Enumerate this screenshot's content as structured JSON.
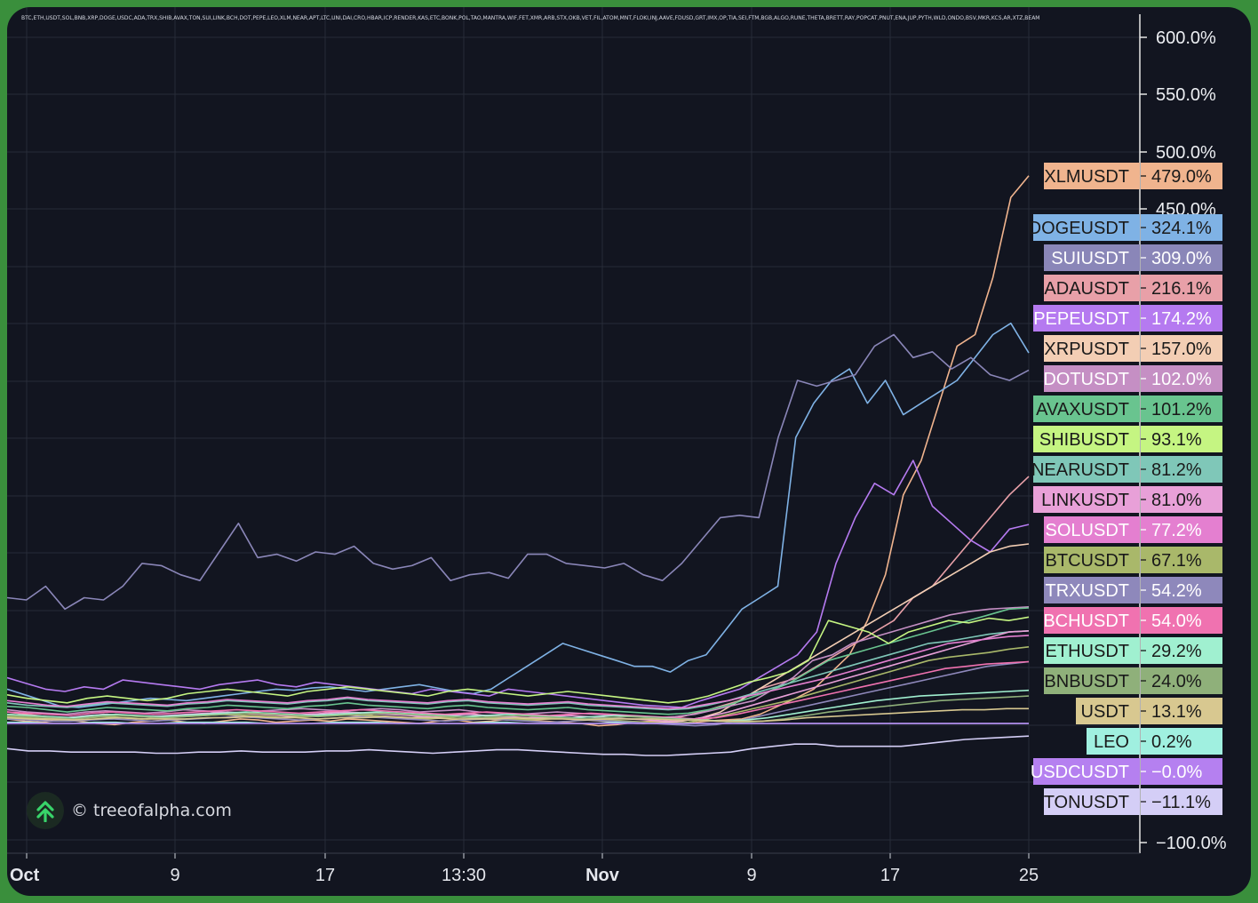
{
  "watermark": {
    "text": "© treeofalpha.com",
    "logo_icon": "tree-of-alpha-logo"
  },
  "chart_data": {
    "type": "line",
    "title": "BTC,ETH,USDT,SOL,BNB,XRP,DOGE,USDC,ADA,TRX,SHIB,AVAX,TON,SUI,LINK,BCH,DOT,PEPE,LEO,XLM,NEAR,APT,LTC,UNI,DAI,CRO,HBAR,ICP,RENDER,KAS,ETC,BONK,POL,TAO,MANTRA,WIF,FET,XMR,ARB,STX,OKB,VET,FIL,ATOM,MNT,FLOKI,INJ,AAVE,FDUSD,GRT,IMX,OP,TIA,SEI,FTM,BGB,ALGO,RUNE,THETA,BRETT,RAY,POPCAT,PNUT,ENA,JUP,PYTH,WLD,ONDO,BSV,MKR,KCS,AR,XTZ,BEAM",
    "x_tick_labels": [
      "Oct",
      "9",
      "17",
      "13:30",
      "Nov",
      "9",
      "17",
      "25"
    ],
    "y_tick_labels": [
      "600.0%",
      "550.0%",
      "500.0%",
      "450.0%",
      "−100.0%"
    ],
    "y_unit": "%",
    "ylim": [
      -100,
      600
    ],
    "grid": true,
    "legend_position": "right-axis-labels",
    "series": [
      {
        "name": "XLMUSDT",
        "value_label": "479.0%",
        "color": "#f0b48e",
        "text_color": "#1a1a1a",
        "values": [
          4,
          2,
          1,
          3,
          2,
          0,
          -1,
          1,
          2,
          3,
          1,
          0,
          2,
          4,
          3,
          1,
          2,
          3,
          2,
          4,
          3,
          2,
          1,
          0,
          2,
          3,
          1,
          2,
          4,
          3,
          2,
          1,
          0,
          -2,
          -1,
          1,
          2,
          1,
          0,
          2,
          3,
          4,
          8,
          15,
          22,
          30,
          45,
          60,
          90,
          130,
          200,
          230,
          280,
          330,
          340,
          390,
          460,
          479
        ]
      },
      {
        "name": "DOGEUSDT",
        "value_label": "324.1%",
        "color": "#7fb2e5",
        "text_color": "#1a1a1a",
        "values": [
          30,
          25,
          20,
          15,
          14,
          16,
          18,
          20,
          22,
          21,
          20,
          22,
          24,
          26,
          28,
          30,
          29,
          31,
          32,
          30,
          28,
          30,
          32,
          34,
          31,
          28,
          26,
          30,
          40,
          50,
          60,
          70,
          65,
          60,
          55,
          50,
          50,
          45,
          55,
          60,
          80,
          100,
          110,
          120,
          250,
          280,
          300,
          310,
          280,
          300,
          270,
          280,
          290,
          300,
          320,
          340,
          350,
          324
        ]
      },
      {
        "name": "SUIUSDT",
        "value_label": "309.0%",
        "color": "#8a86b8",
        "text_color": "#ffffff",
        "values": [
          110,
          108,
          120,
          100,
          110,
          108,
          120,
          140,
          138,
          130,
          125,
          150,
          175,
          145,
          148,
          142,
          150,
          148,
          155,
          140,
          135,
          138,
          145,
          125,
          130,
          132,
          127,
          148,
          148,
          140,
          138,
          136,
          140,
          130,
          125,
          140,
          160,
          180,
          182,
          180,
          250,
          300,
          295,
          300,
          305,
          330,
          340,
          320,
          325,
          310,
          320,
          305,
          300,
          309
        ]
      },
      {
        "name": "ADAUSDT",
        "value_label": "216.1%",
        "color": "#e8a0a8",
        "text_color": "#1a1a1a",
        "values": [
          10,
          8,
          6,
          5,
          6,
          8,
          7,
          6,
          5,
          7,
          8,
          10,
          9,
          8,
          7,
          6,
          8,
          10,
          9,
          7,
          6,
          5,
          7,
          8,
          9,
          6,
          5,
          4,
          6,
          5,
          4,
          3,
          2,
          0,
          2,
          6,
          10,
          15,
          20,
          30,
          35,
          40,
          50,
          60,
          70,
          80,
          90,
          110,
          120,
          140,
          160,
          180,
          200,
          216
        ]
      },
      {
        "name": "PEPEUSDT",
        "value_label": "174.2%",
        "color": "#b57af0",
        "text_color": "#ffffff",
        "values": [
          40,
          35,
          30,
          28,
          32,
          30,
          38,
          36,
          34,
          32,
          30,
          34,
          36,
          38,
          34,
          32,
          36,
          34,
          32,
          30,
          28,
          26,
          30,
          28,
          26,
          24,
          30,
          28,
          26,
          24,
          22,
          20,
          18,
          16,
          15,
          14,
          20,
          25,
          30,
          40,
          50,
          60,
          80,
          140,
          180,
          210,
          200,
          230,
          190,
          175,
          160,
          150,
          170,
          174
        ]
      },
      {
        "name": "XRPUSDT",
        "value_label": "157.0%",
        "color": "#f3ceb4",
        "text_color": "#1a1a1a",
        "values": [
          5,
          4,
          3,
          4,
          5,
          6,
          5,
          4,
          5,
          6,
          7,
          8,
          7,
          6,
          5,
          6,
          7,
          8,
          7,
          6,
          5,
          4,
          5,
          6,
          5,
          4,
          3,
          4,
          5,
          4,
          3,
          2,
          1,
          0,
          1,
          2,
          5,
          10,
          20,
          30,
          40,
          50,
          60,
          70,
          80,
          90,
          100,
          110,
          120,
          130,
          140,
          150,
          155,
          157
        ]
      },
      {
        "name": "DOTUSDT",
        "value_label": "102.0%",
        "color": "#c58fc4",
        "text_color": "#ffffff",
        "values": [
          12,
          10,
          9,
          8,
          10,
          11,
          10,
          9,
          10,
          12,
          11,
          10,
          9,
          11,
          12,
          13,
          12,
          11,
          12,
          13,
          12,
          10,
          11,
          12,
          10,
          9,
          8,
          9,
          10,
          9,
          8,
          7,
          6,
          5,
          6,
          8,
          12,
          16,
          20,
          30,
          40,
          55,
          60,
          70,
          75,
          80,
          85,
          90,
          95,
          98,
          100,
          101,
          102
        ]
      },
      {
        "name": "AVAXUSDT",
        "value_label": "101.2%",
        "color": "#69c48f",
        "text_color": "#1a1a1a",
        "values": [
          15,
          14,
          12,
          10,
          12,
          14,
          13,
          12,
          11,
          13,
          14,
          16,
          15,
          14,
          13,
          15,
          16,
          18,
          16,
          15,
          14,
          13,
          15,
          16,
          14,
          13,
          12,
          13,
          14,
          12,
          11,
          10,
          9,
          8,
          9,
          12,
          16,
          22,
          28,
          35,
          45,
          55,
          60,
          65,
          70,
          75,
          80,
          85,
          90,
          95,
          100,
          101
        ]
      },
      {
        "name": "SHIBUSDT",
        "value_label": "93.1%",
        "color": "#c5f582",
        "text_color": "#1a1a1a",
        "values": [
          25,
          22,
          20,
          18,
          22,
          24,
          22,
          20,
          22,
          26,
          28,
          30,
          28,
          26,
          24,
          28,
          30,
          32,
          30,
          28,
          26,
          24,
          28,
          30,
          28,
          26,
          24,
          26,
          28,
          26,
          24,
          22,
          20,
          18,
          20,
          24,
          30,
          36,
          40,
          45,
          55,
          90,
          85,
          80,
          70,
          80,
          85,
          90,
          88,
          92,
          90,
          93
        ]
      },
      {
        "name": "NEARUSDT",
        "value_label": "81.2%",
        "color": "#7fc7b8",
        "text_color": "#1a1a1a",
        "values": [
          18,
          16,
          15,
          14,
          16,
          18,
          17,
          16,
          15,
          17,
          18,
          20,
          19,
          18,
          17,
          19,
          20,
          22,
          20,
          19,
          18,
          17,
          19,
          20,
          18,
          17,
          16,
          17,
          18,
          16,
          15,
          14,
          13,
          12,
          13,
          16,
          20,
          25,
          30,
          35,
          40,
          45,
          50,
          55,
          60,
          65,
          70,
          72,
          75,
          78,
          80,
          81
        ]
      },
      {
        "name": "LINKUSDT",
        "value_label": "81.0%",
        "color": "#e8a0d8",
        "text_color": "#1a1a1a",
        "values": [
          8,
          7,
          6,
          5,
          7,
          8,
          7,
          6,
          7,
          8,
          9,
          10,
          9,
          8,
          7,
          8,
          9,
          10,
          9,
          8,
          7,
          6,
          7,
          8,
          7,
          6,
          5,
          6,
          7,
          6,
          5,
          4,
          3,
          2,
          3,
          6,
          10,
          15,
          20,
          25,
          30,
          35,
          40,
          45,
          50,
          55,
          60,
          65,
          70,
          75,
          80,
          81
        ]
      },
      {
        "name": "SOLUSDT",
        "value_label": "77.2%",
        "color": "#e47fd0",
        "text_color": "#ffffff",
        "values": [
          20,
          18,
          16,
          15,
          17,
          19,
          18,
          17,
          16,
          18,
          19,
          21,
          20,
          19,
          18,
          20,
          21,
          23,
          21,
          20,
          19,
          18,
          20,
          21,
          19,
          18,
          17,
          18,
          19,
          17,
          16,
          15,
          14,
          13,
          14,
          17,
          20,
          24,
          28,
          32,
          36,
          40,
          45,
          50,
          55,
          60,
          65,
          70,
          72,
          74,
          76,
          77
        ]
      },
      {
        "name": "BTCUSDT",
        "value_label": "67.1%",
        "color": "#a9b86a",
        "text_color": "#1a1a1a",
        "values": [
          6,
          5,
          4,
          3,
          5,
          6,
          5,
          4,
          5,
          6,
          7,
          8,
          7,
          6,
          5,
          6,
          7,
          8,
          7,
          6,
          5,
          4,
          5,
          6,
          5,
          4,
          3,
          4,
          5,
          4,
          3,
          2,
          1,
          0,
          1,
          4,
          8,
          12,
          16,
          20,
          25,
          30,
          35,
          40,
          45,
          50,
          55,
          58,
          60,
          62,
          65,
          67
        ]
      },
      {
        "name": "TRXUSDT",
        "value_label": "54.2%",
        "color": "#8e88bb",
        "text_color": "#ffffff",
        "values": [
          4,
          3,
          2,
          2,
          3,
          4,
          3,
          2,
          3,
          4,
          5,
          6,
          5,
          4,
          3,
          4,
          5,
          6,
          5,
          4,
          3,
          2,
          3,
          4,
          3,
          2,
          1,
          2,
          3,
          2,
          1,
          0,
          -1,
          -2,
          -1,
          2,
          6,
          10,
          14,
          18,
          22,
          26,
          30,
          34,
          38,
          42,
          46,
          50,
          52,
          54
        ]
      },
      {
        "name": "BCHUSDT",
        "value_label": "54.0%",
        "color": "#f072b0",
        "text_color": "#ffffff",
        "values": [
          10,
          9,
          8,
          7,
          9,
          10,
          9,
          8,
          9,
          10,
          11,
          12,
          11,
          10,
          9,
          10,
          11,
          12,
          11,
          10,
          9,
          8,
          9,
          10,
          9,
          8,
          7,
          8,
          9,
          8,
          7,
          6,
          5,
          4,
          5,
          8,
          12,
          16,
          20,
          24,
          28,
          32,
          36,
          40,
          44,
          48,
          50,
          52,
          53,
          54
        ]
      },
      {
        "name": "ETHUSDT",
        "value_label": "29.2%",
        "color": "#a0f0d0",
        "text_color": "#1a1a1a",
        "values": [
          8,
          7,
          6,
          5,
          7,
          8,
          7,
          6,
          7,
          8,
          9,
          10,
          9,
          8,
          7,
          8,
          9,
          10,
          9,
          8,
          7,
          6,
          7,
          8,
          7,
          6,
          5,
          6,
          7,
          6,
          5,
          4,
          3,
          2,
          3,
          5,
          8,
          11,
          14,
          17,
          20,
          22,
          24,
          25,
          26,
          27,
          28,
          29
        ]
      },
      {
        "name": "BNBUSDT",
        "value_label": "24.0%",
        "color": "#8fb07a",
        "text_color": "#1a1a1a",
        "values": [
          7,
          6,
          5,
          4,
          6,
          7,
          6,
          5,
          6,
          7,
          8,
          9,
          8,
          7,
          6,
          7,
          8,
          9,
          8,
          7,
          6,
          5,
          6,
          7,
          6,
          5,
          4,
          5,
          6,
          5,
          4,
          3,
          2,
          1,
          2,
          4,
          7,
          10,
          12,
          14,
          16,
          18,
          20,
          21,
          22,
          23,
          24
        ]
      },
      {
        "name": "USDT",
        "value_label": "13.1%",
        "color": "#d8c890",
        "text_color": "#1a1a1a",
        "values": [
          5,
          4,
          4,
          3,
          4,
          5,
          4,
          4,
          4,
          5,
          5,
          6,
          5,
          5,
          4,
          5,
          5,
          6,
          5,
          5,
          4,
          4,
          4,
          5,
          4,
          4,
          3,
          4,
          4,
          4,
          3,
          3,
          2,
          2,
          2,
          3,
          5,
          6,
          7,
          8,
          9,
          10,
          11,
          12,
          12,
          13,
          13
        ]
      },
      {
        "name": "LEO",
        "value_label": "0.2%",
        "color": "#a0f0e0",
        "text_color": "#1a1a1a",
        "values": [
          1,
          1,
          0,
          0,
          1,
          1,
          0,
          0,
          1,
          1,
          1,
          1,
          0,
          0,
          0,
          1,
          1,
          1,
          0,
          0,
          0,
          0,
          1,
          1,
          0,
          0,
          0,
          0,
          1,
          0,
          0,
          0,
          0,
          0,
          0,
          0,
          0,
          0,
          0,
          0,
          0,
          0,
          0,
          0,
          0,
          0,
          0,
          0
        ]
      },
      {
        "name": "USDCUSDT",
        "value_label": "−0.0%",
        "color": "#b580f0",
        "text_color": "#ffffff",
        "values": [
          0,
          0,
          0,
          0,
          0,
          0,
          0,
          0,
          0,
          0,
          0,
          0,
          0,
          0,
          0,
          0,
          0,
          0,
          0,
          0,
          0,
          0,
          0,
          0,
          0,
          0,
          0,
          0,
          0,
          0,
          0,
          0,
          0,
          0,
          0,
          0,
          0,
          0,
          0,
          0,
          0,
          0,
          0,
          0,
          0,
          0,
          0,
          0
        ]
      },
      {
        "name": "TONUSDT",
        "value_label": "−11.1%",
        "color": "#d4cef6",
        "text_color": "#1a1a1a",
        "values": [
          -22,
          -24,
          -24,
          -25,
          -25,
          -25,
          -25,
          -26,
          -26,
          -25,
          -25,
          -24,
          -25,
          -25,
          -25,
          -24,
          -24,
          -23,
          -24,
          -25,
          -26,
          -25,
          -24,
          -23,
          -23,
          -24,
          -25,
          -26,
          -27,
          -27,
          -28,
          -28,
          -27,
          -26,
          -25,
          -22,
          -20,
          -18,
          -18,
          -20,
          -20,
          -20,
          -20,
          -18,
          -16,
          -14,
          -13,
          -12,
          -11
        ]
      }
    ]
  }
}
